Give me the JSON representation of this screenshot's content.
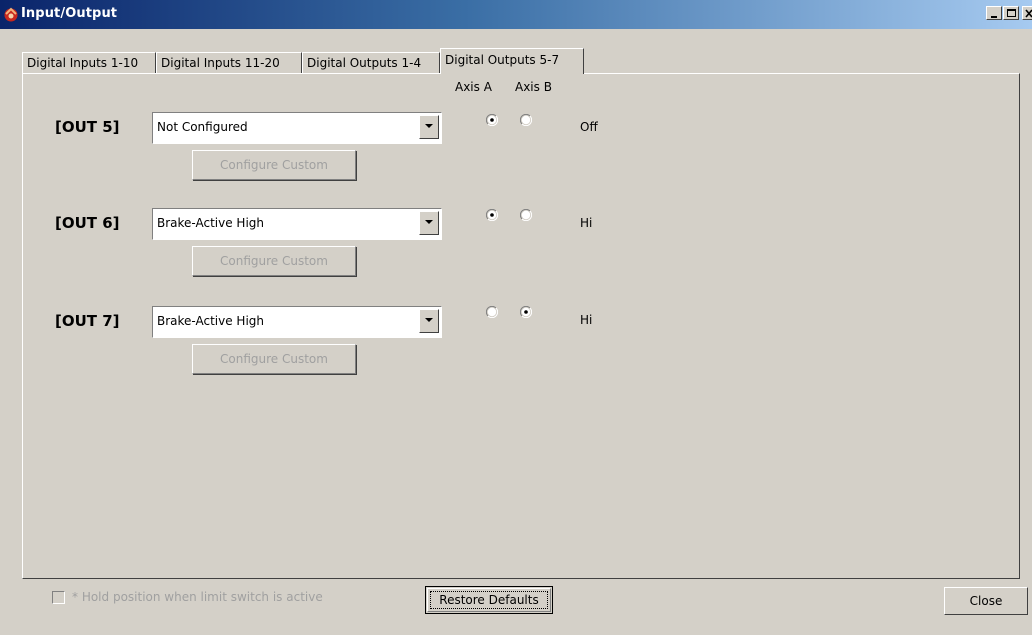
{
  "window": {
    "title": "Input/Output",
    "controls": {
      "minimize": "minimize-icon",
      "maximize": "maximize-icon",
      "close": "close-icon"
    }
  },
  "tabs": [
    {
      "label": "Digital Inputs 1-10",
      "active": false
    },
    {
      "label": "Digital Inputs 11-20",
      "active": false
    },
    {
      "label": "Digital Outputs 1-4",
      "active": false
    },
    {
      "label": "Digital Outputs 5-7",
      "active": true
    }
  ],
  "columns": {
    "axis_a": "Axis A",
    "axis_b": "Axis B"
  },
  "outputs": [
    {
      "label": "[OUT 5]",
      "selection": "Not Configured",
      "configure_label": "Configure Custom",
      "axis": "A",
      "status": "Off"
    },
    {
      "label": "[OUT 6]",
      "selection": "Brake-Active High",
      "configure_label": "Configure Custom",
      "axis": "A",
      "status": "Hi"
    },
    {
      "label": "[OUT 7]",
      "selection": "Brake-Active High",
      "configure_label": "Configure Custom",
      "axis": "B",
      "status": "Hi"
    }
  ],
  "footer": {
    "hold_checkbox_label": "* Hold position when limit switch is active",
    "hold_checked": false,
    "restore_label": "Restore Defaults",
    "close_label": "Close"
  },
  "colors": {
    "title_start": "#0a246a",
    "title_end": "#a6caf0",
    "face": "#d4d0c8",
    "disabled_text": "#a0a0a0"
  }
}
